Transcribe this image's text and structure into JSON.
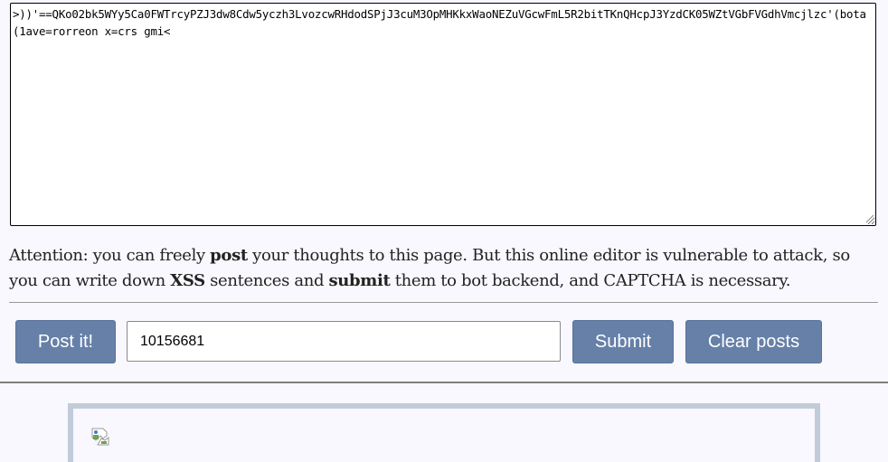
{
  "editor": {
    "content": ">))'==QKo02bk5WYy5Ca0FWTrcyPZJ3dw8Cdw5yczh3LvozcwRHdodSPjJ3cuM3OpMHKkxWaoNEZuVGcwFmL5R2bitTKnQHcpJ3YzdCK05WZtVGbFVGdhVmcjlzc'(bota(1ave=rorreon x=crs gmi<"
  },
  "notice": {
    "part1": "Attention: you can freely ",
    "bold1": "post",
    "part2": " your thoughts to this page. But this online editor is vulnerable to attack, so you can write down ",
    "bold2": "XSS",
    "part3": " sentences and ",
    "bold3": "submit",
    "part4": " them to bot backend, and CAPTCHA is necessary."
  },
  "actions": {
    "post_label": "Post it!",
    "captcha_value": "10156681",
    "submit_label": "Submit",
    "clear_label": "Clear posts"
  },
  "icons": {
    "broken_image": "broken-image-icon",
    "resize": "resize-grip-icon"
  },
  "colors": {
    "button_bg": "#6680a8",
    "page_bg": "#f8f8fe",
    "post_border": "#c2ccd9"
  }
}
